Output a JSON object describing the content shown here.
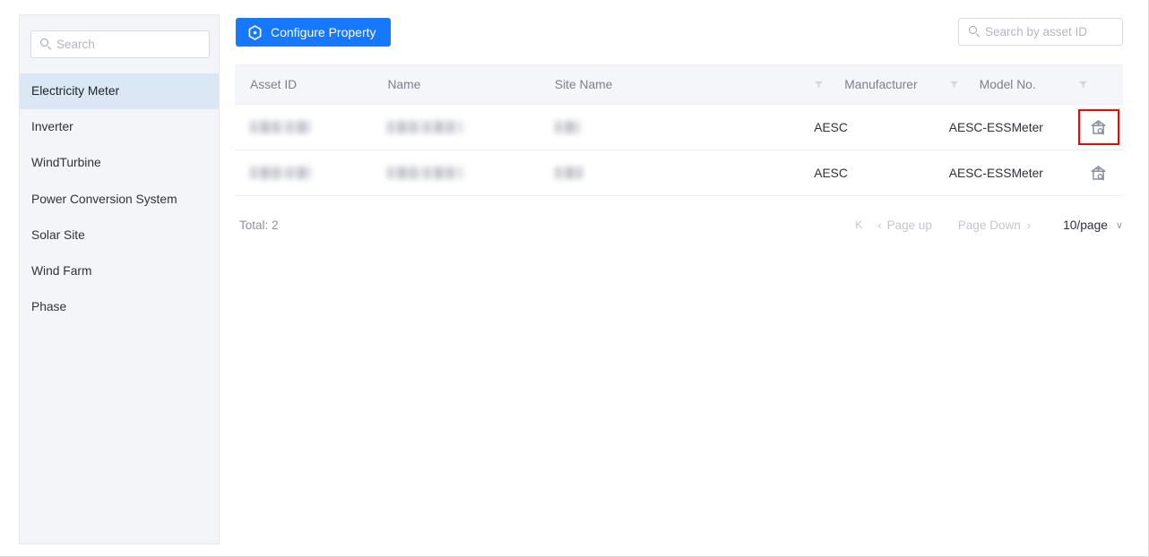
{
  "sidebar": {
    "search": {
      "placeholder": "Search",
      "value": "",
      "icon": "search-icon"
    },
    "items": [
      {
        "label": "Electricity Meter",
        "active": true
      },
      {
        "label": "Inverter",
        "active": false
      },
      {
        "label": "WindTurbine",
        "active": false
      },
      {
        "label": "Power Conversion System",
        "active": false
      },
      {
        "label": "Solar Site",
        "active": false
      },
      {
        "label": "Wind Farm",
        "active": false
      },
      {
        "label": "Phase",
        "active": false
      }
    ]
  },
  "toolbar": {
    "configure_label": "Configure Property",
    "configure_icon": "settings-hexagon-icon",
    "configure_color": "#1677ff",
    "asset_search": {
      "placeholder": "Search by asset ID",
      "value": "",
      "icon": "search-icon"
    }
  },
  "table": {
    "columns": [
      {
        "key": "asset_id",
        "label": "Asset ID",
        "filter": false
      },
      {
        "key": "name",
        "label": "Name",
        "filter": false
      },
      {
        "key": "site_name",
        "label": "Site Name",
        "filter": false
      },
      {
        "key": "manufacturer",
        "label": "Manufacturer",
        "filter": true
      },
      {
        "key": "model_no",
        "label": "Model No.",
        "filter": true
      },
      {
        "key": "action",
        "label": "",
        "filter": true
      }
    ],
    "rows": [
      {
        "asset_id": "",
        "name": "",
        "site_name": "",
        "manufacturer": "AESC",
        "model_no": "AESC-ESSMeter",
        "action_icon": "asset-view-icon",
        "action_highlighted": true,
        "redacted": [
          "asset_id",
          "name",
          "site_name"
        ]
      },
      {
        "asset_id": "",
        "name": "",
        "site_name": "",
        "manufacturer": "AESC",
        "model_no": "AESC-ESSMeter",
        "action_icon": "asset-view-icon",
        "action_highlighted": false,
        "redacted": [
          "asset_id",
          "name",
          "site_name"
        ]
      }
    ]
  },
  "footer": {
    "total_label": "Total: 2",
    "pagination": {
      "first_label": "K",
      "prev_arrow": "‹",
      "page_up_label": "Page up",
      "page_down_label": "Page Down",
      "next_arrow": "›",
      "page_size_label": "10/page",
      "caret": "∨"
    }
  },
  "colors": {
    "accent": "#1677ff",
    "sidebar_bg": "#f4f5f8",
    "sidebar_active_bg": "#dbe7f4",
    "table_head_bg": "#f5f6fa",
    "border": "#eceef3",
    "highlight": "#ff0000",
    "muted_text": "#7c808c"
  }
}
